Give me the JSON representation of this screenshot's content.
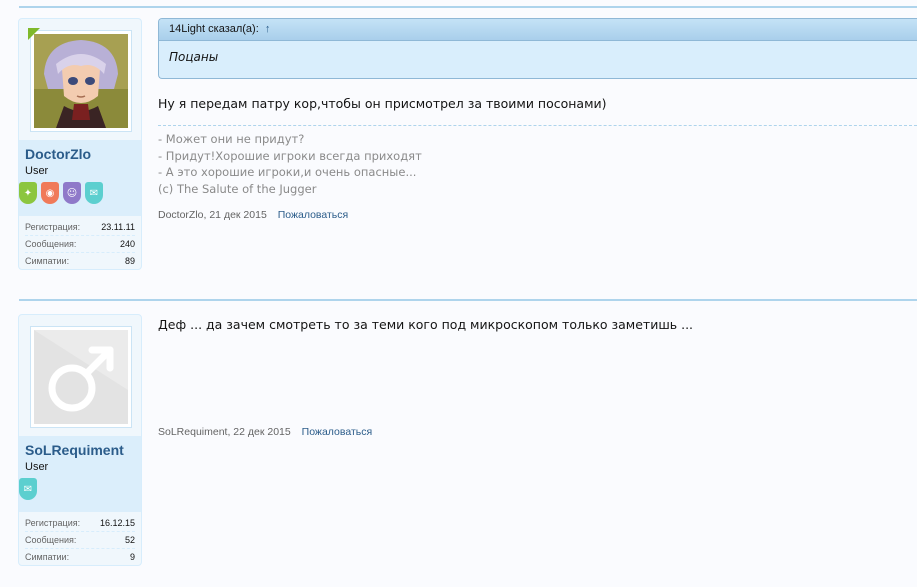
{
  "posts": [
    {
      "author": {
        "name": "DoctorZlo",
        "title": "User",
        "avatar": "anime-portrait",
        "online": true,
        "trophies": [
          {
            "icon": "sparkle-icon",
            "color": "#8cc63f"
          },
          {
            "icon": "lips-icon",
            "color": "#f07a59"
          },
          {
            "icon": "smiley-icon",
            "color": "#8f79c9"
          },
          {
            "icon": "chat-icon",
            "color": "#5ccfcf"
          }
        ],
        "stats": [
          {
            "label": "Регистрация:",
            "value": "23.11.11"
          },
          {
            "label": "Сообщения:",
            "value": "240"
          },
          {
            "label": "Симпатии:",
            "value": "89"
          }
        ]
      },
      "quote": {
        "header": "14Light сказал(а):",
        "arrow": "↑",
        "text": "Поцаны"
      },
      "message": "Ну я передам патру кор,чтобы он присмотрел за твоими посонами)",
      "signature": [
        "- Может они не придут?",
        "- Придут!Хорошие игроки всегда приходят",
        "- А это хорошие игроки,и очень опасные...",
        "(c) The Salute of the Jugger"
      ],
      "meta": {
        "byline": "DoctorZlo, 21 дек 2015",
        "report": "Пожаловаться"
      }
    },
    {
      "author": {
        "name": "SoLRequiment",
        "title": "User",
        "avatar": "default-male-avatar",
        "online": false,
        "trophies": [
          {
            "icon": "chat-icon",
            "color": "#5ccfcf"
          }
        ],
        "stats": [
          {
            "label": "Регистрация:",
            "value": "16.12.15"
          },
          {
            "label": "Сообщения:",
            "value": "52"
          },
          {
            "label": "Симпатии:",
            "value": "9"
          }
        ]
      },
      "message": "Деф ... да зачем смотреть то за теми кого под микроскопом только заметишь ...",
      "meta": {
        "byline": "SoLRequiment, 22 дек 2015",
        "report": "Пожаловаться"
      }
    }
  ],
  "colors": {
    "accent": "#2b5c8a",
    "separator": "#aed4ec",
    "panel": "#f0f7fc"
  }
}
